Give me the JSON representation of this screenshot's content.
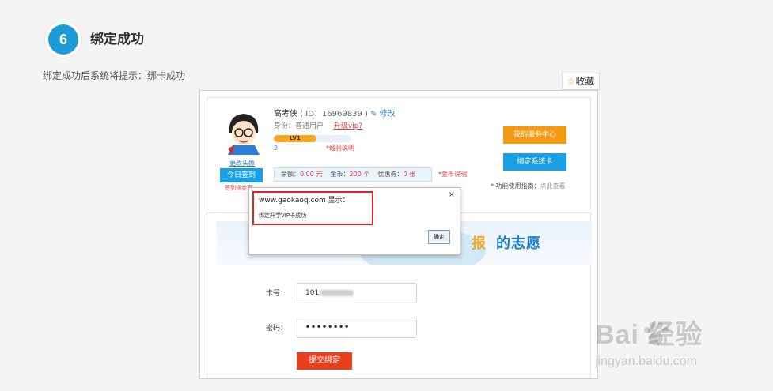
{
  "step": {
    "number": "6",
    "title": "绑定成功",
    "description": "绑定成功后系统将提示：绑卡成功"
  },
  "favorite": {
    "icon": "star-icon",
    "label": "收藏"
  },
  "user_panel": {
    "name": "高考侠",
    "id_text": "( ID：16969839 )",
    "edit_label": "修改",
    "identity_label": "身份：普通用户",
    "upgrade_label": "升级vip?",
    "avatar_edit_label": "更改头像",
    "level_label": "LV1",
    "level_progress": 0.55,
    "level_number": "2",
    "level_explain": "*经验说明",
    "checkin_button": "今日签到",
    "checkin_note": "签到送金币",
    "balance": {
      "balance_label": "余额：",
      "balance_value": "0.00 元",
      "gold_label": "金币：",
      "gold_value": "200 个",
      "coupon_label": "优惠券：",
      "coupon_value": "0 张"
    },
    "gold_explain": "*金币说明",
    "service_button": "我的服务中心",
    "bind_button": "绑定系统卡",
    "guide_text": "* 功能使用指南：",
    "guide_link": "点此查看"
  },
  "banner": {
    "highlight": "报",
    "text": "的志愿"
  },
  "form": {
    "card_label": "卡号：",
    "card_value": "101",
    "password_label": "密码：",
    "password_value": "••••••••",
    "submit_button": "提交绑定"
  },
  "dialog": {
    "title": "www.gaokaoq.com 显示：",
    "message": "绑定升学VIP卡成功",
    "ok_button": "确定",
    "close": "×"
  },
  "watermark": {
    "logo": "Bai 经验",
    "url": "jingyan.baidu.com"
  },
  "colors": {
    "accent_blue": "#1d9bd7",
    "orange": "#f49a12",
    "red": "#e4393c",
    "submit_red": "#e8401e",
    "highlight_border": "#e02222"
  }
}
